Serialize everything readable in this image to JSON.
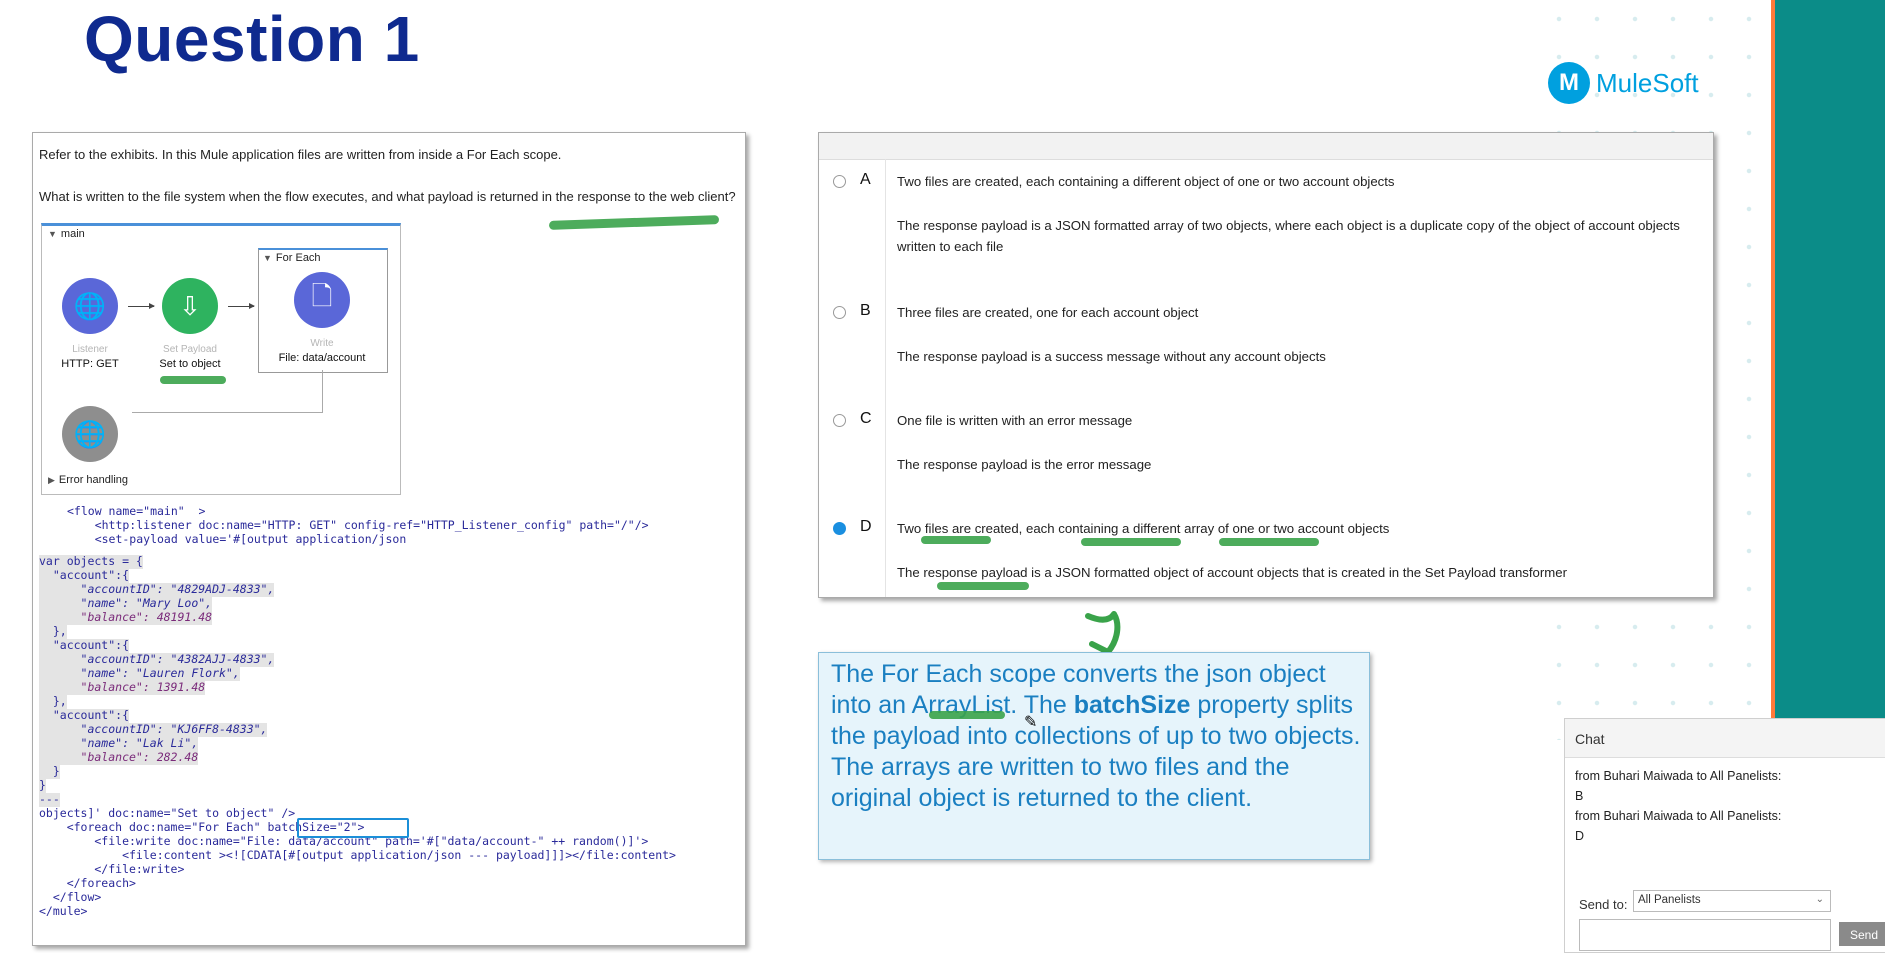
{
  "title": "Question 1",
  "logo": {
    "name": "MuleSoft",
    "icon": "mulesoft-m-icon",
    "color": "#00a0df"
  },
  "colors": {
    "title": "#0f2a8f",
    "teal": "#0b8c88",
    "accent_orange": "#ff7a3a",
    "explain_text": "#1a7fc1",
    "highlight_green": "#3aa34a"
  },
  "exhibit": {
    "intro": "Refer to the exhibits. In this Mule application files are written from inside a For Each scope.",
    "question": "What is written to the file system when the flow executes, and what payload is returned in the response to the web client?",
    "flow": {
      "main_label": "main",
      "foreach_label": "For Each",
      "error_handling_label": "Error handling",
      "nodes": [
        {
          "sub": "Listener",
          "label": "HTTP: GET"
        },
        {
          "sub": "Set Payload",
          "label": "Set to object"
        },
        {
          "sub": "Write",
          "label": "File: data/account"
        }
      ]
    },
    "code_lines": [
      "<flow name=\"main\"  >",
      "    <http:listener doc:name=\"HTTP: GET\" config-ref=\"HTTP_Listener_config\" path=\"/\"/>",
      "    <set-payload value='#[output application/json",
      "var objects = {",
      "  \"account\":{",
      "      \"accountID\": \"4829ADJ-4833\",",
      "      \"name\": \"Mary Loo\",",
      "      \"balance\": 48191.48",
      "  },",
      "  \"account\":{",
      "      \"accountID\": \"4382AJJ-4833\",",
      "      \"name\": \"Lauren Flork\",",
      "      \"balance\": 1391.48",
      "  },",
      "  \"account\":{",
      "      \"accountID\": \"KJ6FF8-4833\",",
      "      \"name\": \"Lak Li\",",
      "      \"balance\": 282.48",
      "  }",
      "}",
      "---",
      "objects]' doc:name=\"Set to object\" />",
      "    <foreach doc:name=\"For Each\" batchSize=\"2\">",
      "        <file:write doc:name=\"File: data/account\" path='#[\"data/account-\" ++ random()]'>",
      "            <file:content ><![CDATA[#[output application/json --- payload]]]></file:content>",
      "        </file:write>",
      "    </foreach>",
      "  </flow>",
      "</mule>"
    ]
  },
  "options": [
    {
      "letter": "A",
      "line1": "Two files are created, each containing a different object of one or two account objects",
      "line2": "The response payload is a JSON formatted array of two objects, where each object is a duplicate copy of the object of account objects written to each file",
      "selected": false
    },
    {
      "letter": "B",
      "line1": "Three files are created, one for each account object",
      "line2": "The response payload is a success message without any account objects",
      "selected": false
    },
    {
      "letter": "C",
      "line1": "One file is written with an error message",
      "line2": "The response payload is the error message",
      "selected": false
    },
    {
      "letter": "D",
      "line1": "Two files are created, each containing a different array of one or two account objects",
      "line2": "The response payload is a JSON formatted object of account objects that is created in the Set Payload transformer",
      "selected": true
    }
  ],
  "explanation": {
    "part1": "The For Each scope converts the json object into an ArrayList. The ",
    "bold": "batchSize",
    "part2": " property splits the payload into collections of up to two objects. The arrays are written to two files and the original object is returned to the client."
  },
  "chat": {
    "title": "Chat",
    "messages": [
      {
        "from": "from Buhari Maiwada to All Panelists:",
        "text": "B"
      },
      {
        "from": "from Buhari Maiwada to All Panelists:",
        "text": "D"
      }
    ],
    "send_to_label": "Send to:",
    "send_to_value": "All Panelists",
    "send_label": "Send"
  }
}
